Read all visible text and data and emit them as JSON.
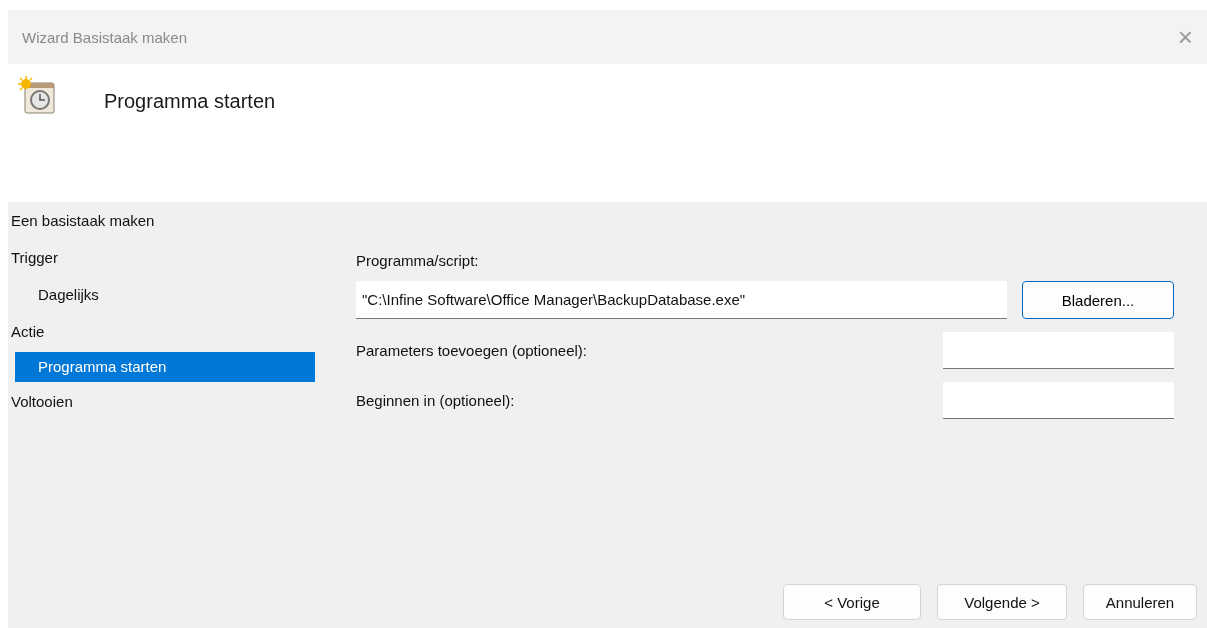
{
  "window": {
    "title": "Wizard Basistaak maken",
    "close": "×"
  },
  "header": {
    "title": "Programma starten"
  },
  "sidebar": {
    "items": [
      {
        "label": "Een basistaak maken",
        "selected": false
      },
      {
        "label": "Trigger",
        "selected": false,
        "children": [
          {
            "label": "Dagelijks",
            "selected": false
          }
        ]
      },
      {
        "label": "Actie",
        "selected": false,
        "children": [
          {
            "label": "Programma starten",
            "selected": true
          }
        ]
      },
      {
        "label": "Voltooien",
        "selected": false
      }
    ]
  },
  "form": {
    "program_label": "Programma/script:",
    "program_value": "\"C:\\Infine Software\\Office Manager\\BackupDatabase.exe\"",
    "browse": "Bladeren...",
    "fields": [
      {
        "label": "Parameters toevoegen (optioneel):"
      },
      {
        "label": "Beginnen in (optioneel):"
      }
    ]
  },
  "buttons": [
    "< Vorige",
    "Volgende >",
    "Annuleren"
  ]
}
